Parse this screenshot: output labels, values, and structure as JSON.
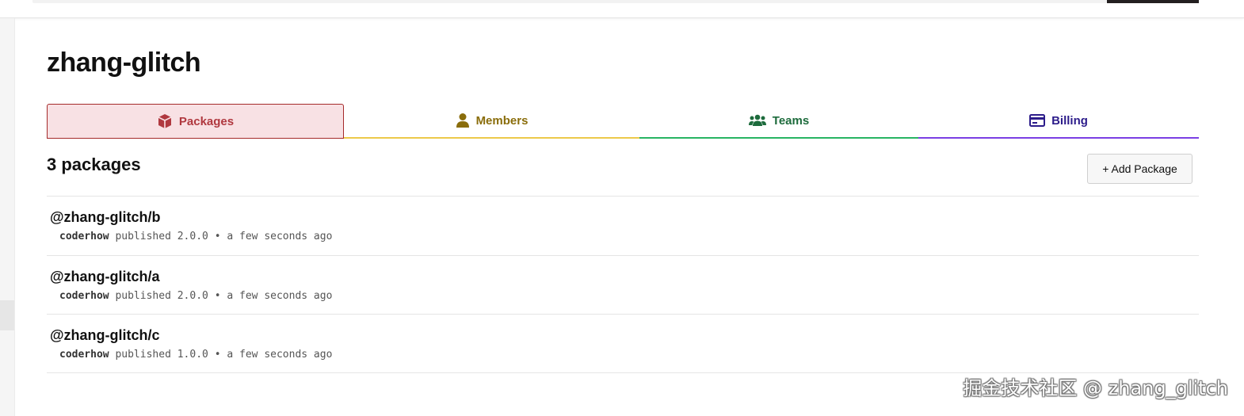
{
  "org": {
    "name": "zhang-glitch"
  },
  "tabs": [
    {
      "label": "Packages",
      "icon": "package-icon",
      "color": "#b0383f",
      "active": true
    },
    {
      "label": "Members",
      "icon": "user-icon",
      "color": "#8a6d0b",
      "active": false
    },
    {
      "label": "Teams",
      "icon": "users-icon",
      "color": "#1d6b3c",
      "active": false
    },
    {
      "label": "Billing",
      "icon": "credit-card-icon",
      "color": "#2c1c8a",
      "active": false
    }
  ],
  "packages": {
    "count_label": "3 packages",
    "add_button_label": "+ Add Package",
    "items": [
      {
        "name": "@zhang-glitch/b",
        "author": "coderhow",
        "action": "published",
        "version": "2.0.0",
        "separator": "•",
        "time": "a few seconds ago"
      },
      {
        "name": "@zhang-glitch/a",
        "author": "coderhow",
        "action": "published",
        "version": "2.0.0",
        "separator": "•",
        "time": "a few seconds ago"
      },
      {
        "name": "@zhang-glitch/c",
        "author": "coderhow",
        "action": "published",
        "version": "1.0.0",
        "separator": "•",
        "time": "a few seconds ago"
      }
    ]
  },
  "watermark": "掘金技术社区 @ zhang_glitch"
}
